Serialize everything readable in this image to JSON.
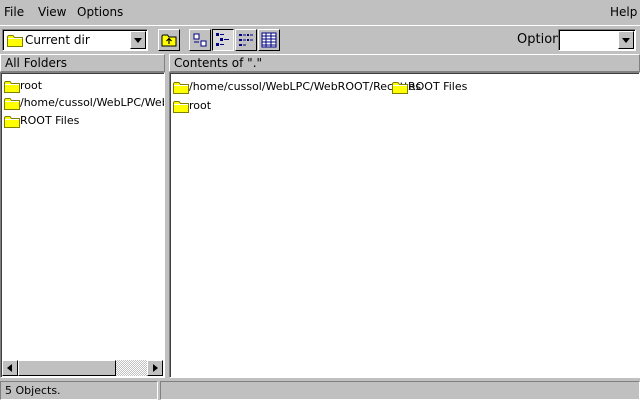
{
  "menu": {
    "file": "File",
    "view": "View",
    "options": "Options",
    "help": "Help"
  },
  "toolbar": {
    "location_value": "Current dir",
    "option_label": "Option",
    "option_value": "",
    "buttons": [
      "folder-up-icon",
      "large-icons-view-icon",
      "small-icons-view-icon",
      "list-view-icon",
      "details-view-icon"
    ],
    "pressed_view": "small-icons-view-icon"
  },
  "left_pane": {
    "header": "All Folders",
    "items": [
      {
        "label": "root",
        "icon": "folder-icon"
      },
      {
        "label": "/home/cussol/WebLPC/WebROOT/Recettes",
        "icon": "folder-icon"
      },
      {
        "label": "ROOT Files",
        "icon": "folder-icon"
      }
    ]
  },
  "right_pane": {
    "header": "Contents of \".\"",
    "items": [
      {
        "label": "/home/cussol/WebLPC/WebROOT/Recettes",
        "icon": "folder-icon"
      },
      {
        "label": "ROOT Files",
        "icon": "folder-icon"
      },
      {
        "label": "root",
        "icon": "folder-icon"
      }
    ]
  },
  "status": {
    "objects": "5 Objects.",
    "secondary": ""
  },
  "colors": {
    "window_bg": "#c0c0c0",
    "pane_bg": "#ffffff",
    "folder_fill": "#ffff00",
    "folder_outline": "#808000"
  }
}
